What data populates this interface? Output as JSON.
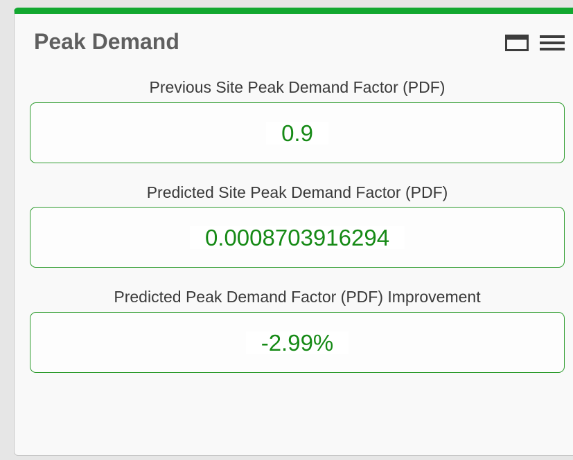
{
  "panel": {
    "title": "Peak Demand",
    "accent_color": "#12a830",
    "value_color": "#168a16",
    "icons": [
      "maximize-window-icon",
      "hamburger-menu-icon"
    ]
  },
  "metrics": [
    {
      "label": "Previous Site Peak Demand Factor (PDF)",
      "value": "0.9"
    },
    {
      "label": "Predicted Site Peak Demand Factor (PDF)",
      "value": "0.0008703916294"
    },
    {
      "label": "Predicted Peak Demand Factor (PDF) Improvement",
      "value": "-2.99%"
    }
  ]
}
